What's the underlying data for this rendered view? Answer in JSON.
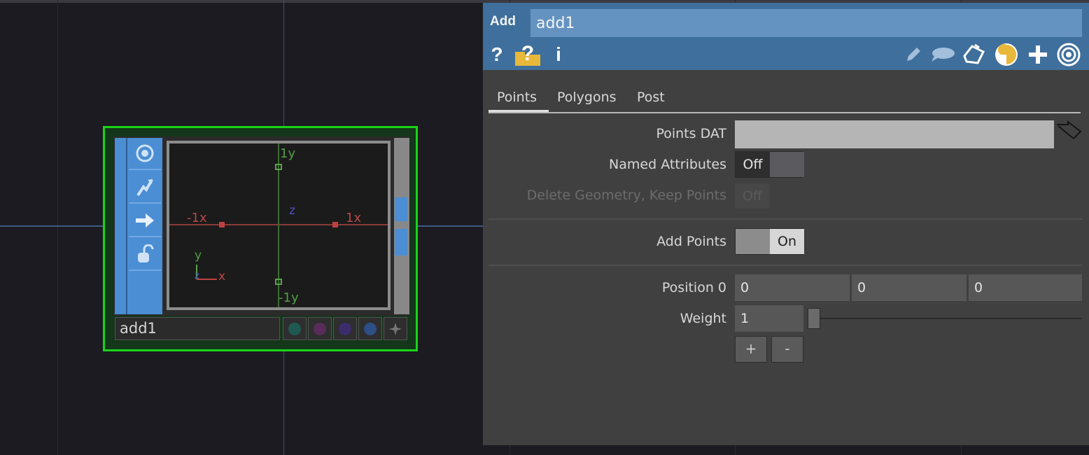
{
  "network": {
    "node": {
      "name": "add1",
      "viewer": {
        "label_pos_y": "1y",
        "label_neg_y": "-1y",
        "label_pos_x": "1x",
        "label_neg_x": "-1x",
        "label_z": "z",
        "gizmo_y": "y",
        "gizmo_x": "x",
        "gizmo_z": "z"
      },
      "side_icons": [
        "viewer-active-icon",
        "bypass-icon",
        "display-arrow-icon",
        "lock-icon"
      ],
      "flag_colors": [
        "#1f5a52",
        "#5a2c5a",
        "#3b2d6b",
        "#2c4f86"
      ]
    },
    "colors": {
      "node_border": "#19d419",
      "node_accent": "#4b8ed3"
    }
  },
  "panel": {
    "op_type": "Add",
    "op_name": "add1",
    "header_left_icons": [
      "help-icon",
      "python-help-icon",
      "info-icon"
    ],
    "header_right_icons": [
      "edit-icon",
      "comment-icon",
      "copy-icon",
      "python-icon",
      "add-icon",
      "viewer-icon"
    ],
    "help_glyph": "?",
    "info_glyph": "i",
    "tabs": [
      "Points",
      "Polygons",
      "Post"
    ],
    "active_tab": "Points",
    "params": {
      "points_dat": {
        "label": "Points DAT",
        "value": ""
      },
      "named_attributes": {
        "label": "Named Attributes",
        "value": "Off"
      },
      "delete_geometry": {
        "label": "Delete Geometry, Keep Points",
        "value": "Off"
      },
      "add_points": {
        "label": "Add Points",
        "value": "On"
      },
      "position0": {
        "label": "Position 0",
        "x": "0",
        "y": "0",
        "z": "0"
      },
      "weight": {
        "label": "Weight",
        "value": "1"
      }
    },
    "plus_label": "+",
    "minus_label": "-",
    "colors": {
      "header": "#3f6f9c",
      "name_field": "#6593c1",
      "background": "#404040"
    }
  }
}
